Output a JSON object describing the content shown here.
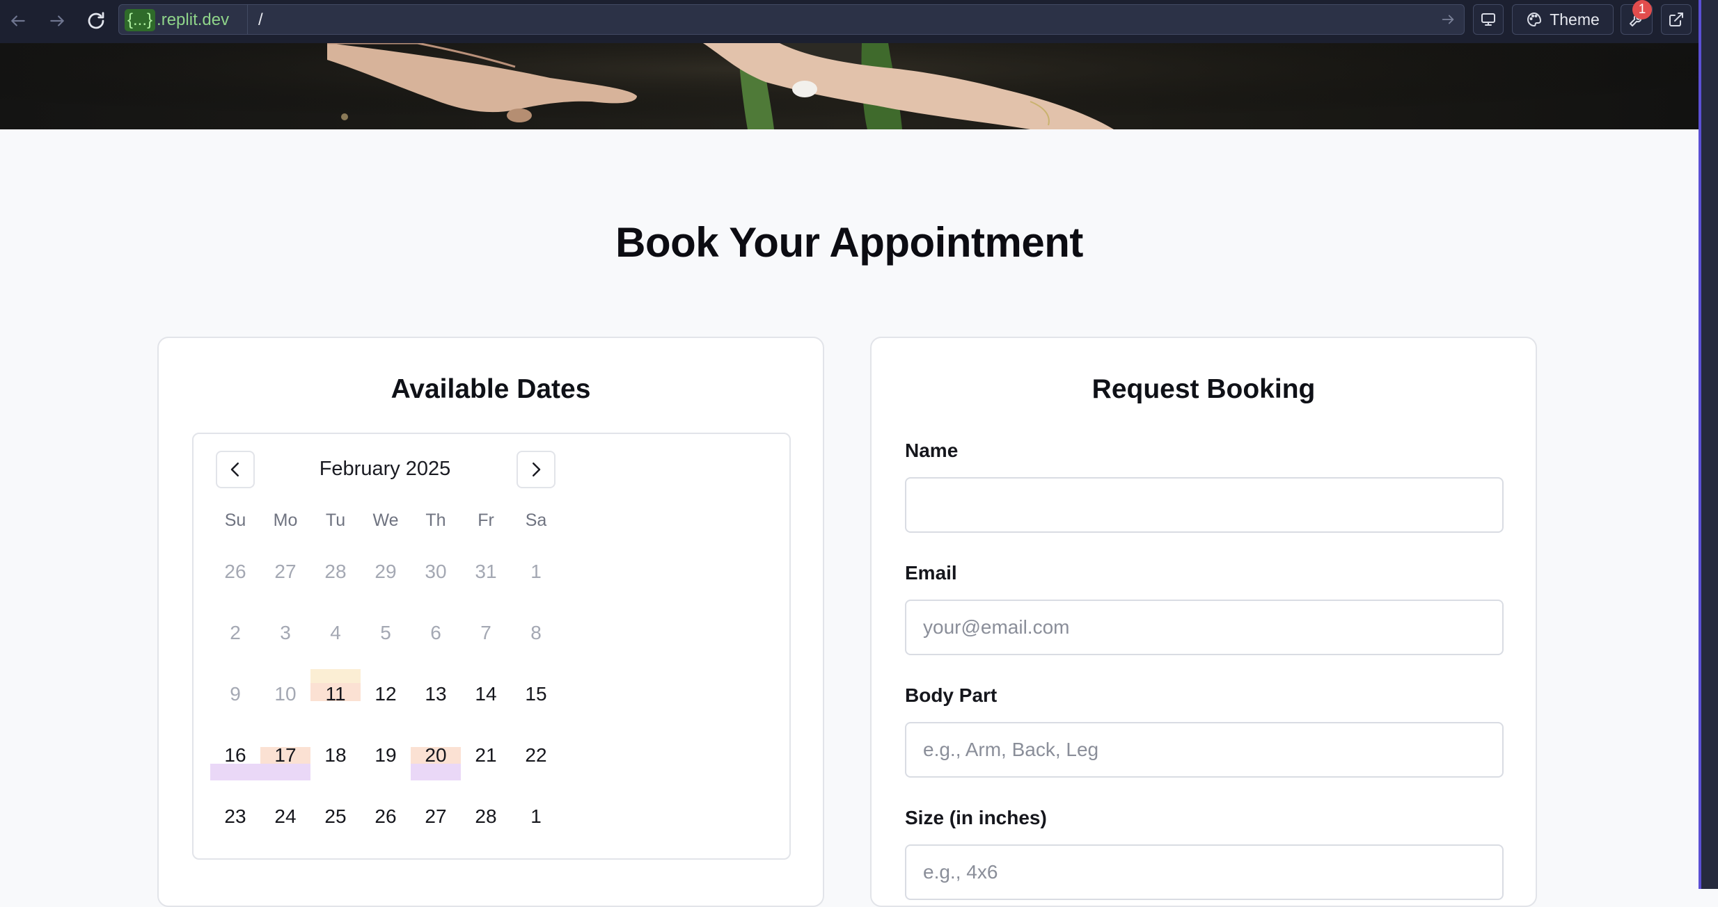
{
  "browser": {
    "url_host_tag": "{...}",
    "url_host": ".replit.dev",
    "url_path": "/",
    "theme_label": "Theme",
    "notification_count": "1"
  },
  "page": {
    "title": "Book Your Appointment"
  },
  "calendar_card": {
    "title": "Available Dates",
    "month_label": "February 2025",
    "weekdays": [
      "Su",
      "Mo",
      "Tu",
      "We",
      "Th",
      "Fr",
      "Sa"
    ],
    "weeks": [
      [
        "26",
        "27",
        "28",
        "29",
        "30",
        "31",
        "1"
      ],
      [
        "2",
        "3",
        "4",
        "5",
        "6",
        "7",
        "8"
      ],
      [
        "9",
        "10",
        "11",
        "12",
        "13",
        "14",
        "15"
      ],
      [
        "16",
        "17",
        "18",
        "19",
        "20",
        "21",
        "22"
      ],
      [
        "23",
        "24",
        "25",
        "26",
        "27",
        "28",
        "1"
      ]
    ],
    "highlight_colors": {
      "peach": "#fbe1d3",
      "cream": "#fbeed4",
      "lavender": "#ead8f7"
    }
  },
  "booking_card": {
    "title": "Request Booking",
    "fields": [
      {
        "label": "Name",
        "placeholder": "",
        "value": ""
      },
      {
        "label": "Email",
        "placeholder": "your@email.com",
        "value": ""
      },
      {
        "label": "Body Part",
        "placeholder": "e.g., Arm, Back, Leg",
        "value": ""
      },
      {
        "label": "Size (in inches)",
        "placeholder": "e.g., 4x6",
        "value": ""
      }
    ]
  }
}
